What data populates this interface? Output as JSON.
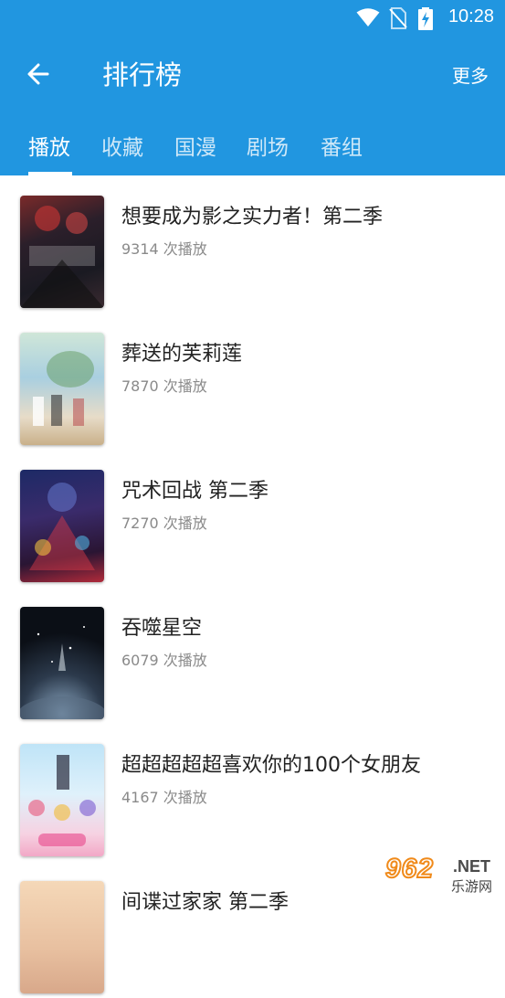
{
  "status_bar": {
    "time": "10:28",
    "icons": [
      "wifi-icon",
      "no-sim-icon",
      "battery-charging-icon"
    ]
  },
  "toolbar": {
    "back_icon": "arrow-left-icon",
    "title": "排行榜",
    "more_label": "更多"
  },
  "tabs": [
    {
      "label": "播放",
      "active": true
    },
    {
      "label": "收藏",
      "active": false
    },
    {
      "label": "国漫",
      "active": false
    },
    {
      "label": "剧场",
      "active": false
    },
    {
      "label": "番组",
      "active": false
    }
  ],
  "items": [
    {
      "title": "想要成为影之实力者！第二季",
      "plays": "9314 次播放"
    },
    {
      "title": "葬送的芙莉莲",
      "plays": "7870 次播放"
    },
    {
      "title": "咒术回战 第二季",
      "plays": "7270 次播放"
    },
    {
      "title": "吞噬星空",
      "plays": "6079 次播放"
    },
    {
      "title": "超超超超超喜欢你的100个女朋友",
      "plays": "4167 次播放"
    },
    {
      "title": "间谍过家家 第二季",
      "plays": ""
    }
  ],
  "watermark": {
    "number": "962",
    "suffix": ".NET",
    "site": "乐游网"
  },
  "colors": {
    "accent": "#2196e0",
    "title_text": "#222222",
    "meta_text": "#8a8a8a"
  }
}
